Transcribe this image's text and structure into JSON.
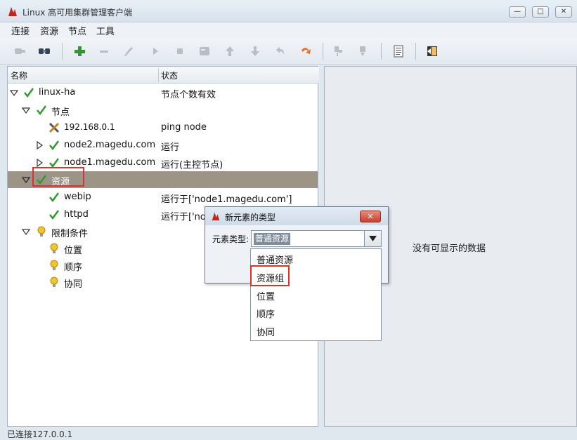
{
  "window": {
    "title": "Linux 高可用集群管理客户端"
  },
  "menu": [
    "连接",
    "资源",
    "节点",
    "工具"
  ],
  "toolbar": {
    "icons": [
      "connect-icon",
      "disconnect-icon",
      "add-icon",
      "remove-icon",
      "cleanup-icon",
      "start-icon",
      "stop-icon",
      "migrate-icon",
      "up-icon",
      "down-icon",
      "undo-icon",
      "redo-icon",
      "standby-icon",
      "active-icon",
      "log-icon",
      "exit-icon"
    ]
  },
  "tree": {
    "headers": {
      "name": "名称",
      "status": "状态"
    },
    "rows": [
      {
        "name": "linux-ha",
        "status": "节点个数有效"
      },
      {
        "name": "节点",
        "status": ""
      },
      {
        "name": "192.168.0.1",
        "status": "ping node"
      },
      {
        "name": "node2.magedu.com",
        "status": "运行"
      },
      {
        "name": "node1.magedu.com",
        "status": "运行(主控节点)"
      },
      {
        "name": "资源",
        "status": ""
      },
      {
        "name": "webip",
        "status": "运行于['node1.magedu.com']"
      },
      {
        "name": "httpd",
        "status": "运行于['no"
      },
      {
        "name": "限制条件",
        "status": ""
      },
      {
        "name": "位置",
        "status": ""
      },
      {
        "name": "顺序",
        "status": ""
      },
      {
        "name": "协同",
        "status": ""
      }
    ]
  },
  "right_panel": {
    "empty_text": "没有可显示的数据"
  },
  "dialog": {
    "title": "新元素的类型",
    "label": "元素类型:",
    "selected": "普通资源",
    "options": [
      "普通资源",
      "资源组",
      "位置",
      "顺序",
      "协同"
    ]
  },
  "statusbar": {
    "text": "已连接127.0.0.1"
  },
  "colors": {
    "highlight": "#e0302e",
    "selected_row": "#9c9587",
    "check": "#2e9a2e"
  }
}
